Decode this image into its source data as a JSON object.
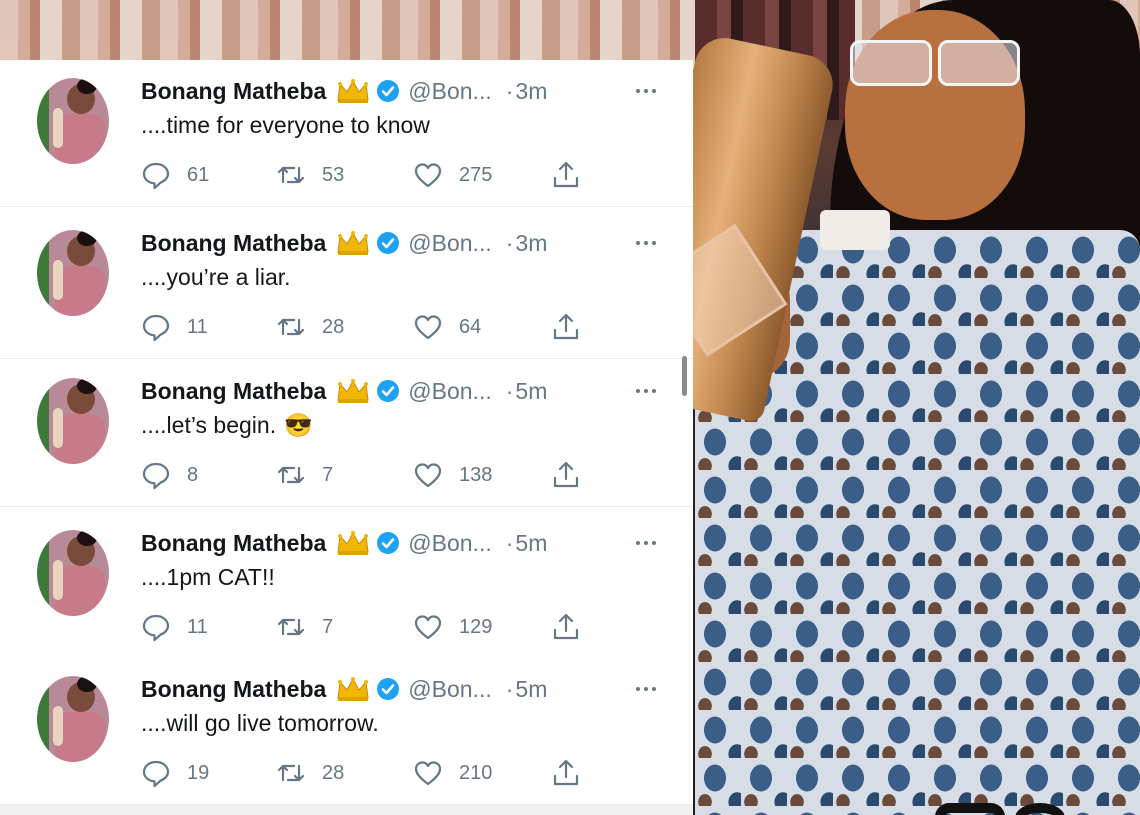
{
  "tweets": [
    {
      "name": "Bonang Matheba",
      "handle": "@Bon...",
      "separator": "·",
      "time": "3m",
      "text": "....time for everyone to know",
      "emoji": "",
      "replies": "61",
      "retweets": "53",
      "likes": "275"
    },
    {
      "name": "Bonang Matheba",
      "handle": "@Bon...",
      "separator": "·",
      "time": "3m",
      "text": "....you’re a liar.",
      "emoji": "",
      "replies": "11",
      "retweets": "28",
      "likes": "64"
    },
    {
      "name": "Bonang Matheba",
      "handle": "@Bon...",
      "separator": "·",
      "time": "5m",
      "text": "....let’s begin.",
      "emoji": "😎",
      "replies": "8",
      "retweets": "7",
      "likes": "138"
    },
    {
      "name": "Bonang Matheba",
      "handle": "@Bon...",
      "separator": "·",
      "time": "5m",
      "text": "....1pm CAT!!",
      "emoji": "",
      "replies": "11",
      "retweets": "7",
      "likes": "129"
    },
    {
      "name": "Bonang Matheba",
      "handle": "@Bon...",
      "separator": "·",
      "time": "5m",
      "text": "....will go live tomorrow.",
      "emoji": "",
      "replies": "19",
      "retweets": "28",
      "likes": "210"
    }
  ],
  "icons": {
    "reply": "reply-icon",
    "retweet": "retweet-icon",
    "like": "heart-icon",
    "share": "share-icon",
    "verified": "verified-badge-icon",
    "crown": "crown-icon",
    "more": "more-icon"
  },
  "colors": {
    "verified": "#1da1f2",
    "meta": "#657786",
    "text": "#14171a",
    "crown": "#f2b705"
  }
}
